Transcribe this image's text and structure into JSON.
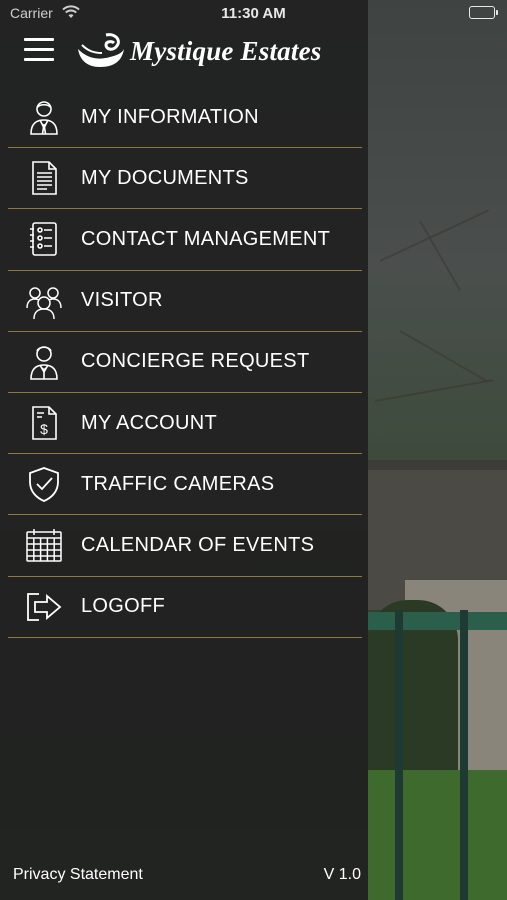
{
  "status_bar": {
    "carrier": "Carrier",
    "time": "11:30 AM"
  },
  "header": {
    "app_title": "Mystique Estates",
    "menu_icon": "hamburger-icon",
    "logo_icon": "swan-icon"
  },
  "menu": {
    "items": [
      {
        "label": "MY INFORMATION",
        "icon": "user-icon"
      },
      {
        "label": "MY DOCUMENTS",
        "icon": "document-icon"
      },
      {
        "label": "CONTACT MANAGEMENT",
        "icon": "contact-list-icon"
      },
      {
        "label": "VISITOR",
        "icon": "visitors-group-icon"
      },
      {
        "label": "CONCIERGE REQUEST",
        "icon": "concierge-icon"
      },
      {
        "label": "MY ACCOUNT",
        "icon": "invoice-dollar-icon"
      },
      {
        "label": "TRAFFIC CAMERAS",
        "icon": "shield-check-icon"
      },
      {
        "label": "CALENDAR OF EVENTS",
        "icon": "calendar-icon"
      },
      {
        "label": "LOGOFF",
        "icon": "logoff-arrow-icon"
      }
    ]
  },
  "footer": {
    "privacy_label": "Privacy Statement",
    "version": "V 1.0"
  },
  "colors": {
    "drawer_bg": "#202020",
    "divider": "#8d7a3c",
    "text": "#ffffff"
  }
}
